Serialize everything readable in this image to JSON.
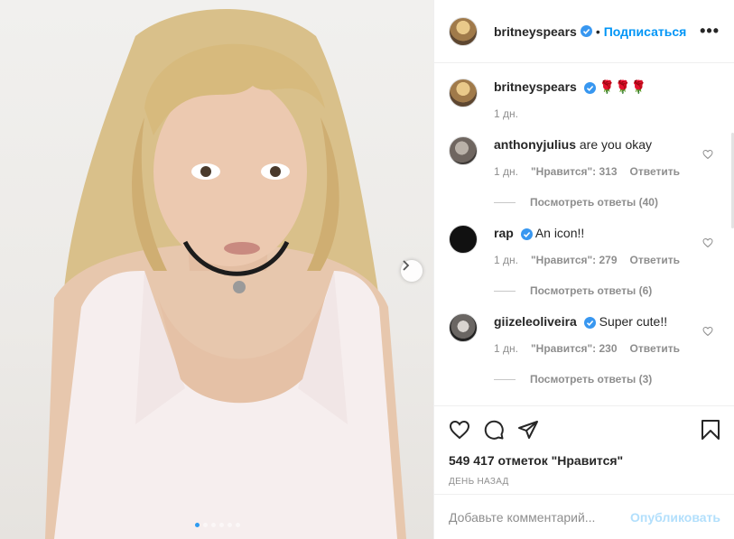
{
  "post": {
    "image_description_icon": "photo-icon",
    "carousel_next_icon": "chevron-right-icon",
    "carousel_dots": 6,
    "carousel_active_index": 0
  },
  "header": {
    "username": "britneyspears",
    "bullet": "•",
    "follow_label": "Подписаться",
    "more_label": "•••"
  },
  "caption": {
    "username": "britneyspears",
    "text": "🌹🌹🌹",
    "time": "1 дн."
  },
  "comments": [
    {
      "username": "anthonyjulius",
      "verified": false,
      "text": "are you okay",
      "time": "1 дн.",
      "likes": "\"Нравится\": 313",
      "reply_label": "Ответить",
      "view_replies": "Посмотреть ответы (40)"
    },
    {
      "username": "rap",
      "verified": true,
      "text": "An icon!!",
      "time": "1 дн.",
      "likes": "\"Нравится\": 279",
      "reply_label": "Ответить",
      "view_replies": "Посмотреть ответы (6)"
    },
    {
      "username": "giizeleoliveira",
      "verified": true,
      "text": "Super cute!!",
      "time": "1 дн.",
      "likes": "\"Нравится\": 230",
      "reply_label": "Ответить",
      "view_replies": "Посмотреть ответы (3)"
    }
  ],
  "actions": {
    "like_icon": "heart-icon",
    "comment_icon": "comment-icon",
    "share_icon": "paper-plane-icon",
    "save_icon": "bookmark-icon",
    "likes_text": "549 417 отметок \"Нравится\"",
    "date": "День назад"
  },
  "add_comment": {
    "placeholder": "Добавьте комментарий...",
    "publish_label": "Опубликовать"
  },
  "colors": {
    "accent": "#0095f6",
    "verified": "#3897f0",
    "publish_disabled": "#b2dffc",
    "muted": "#8e8e8e"
  }
}
